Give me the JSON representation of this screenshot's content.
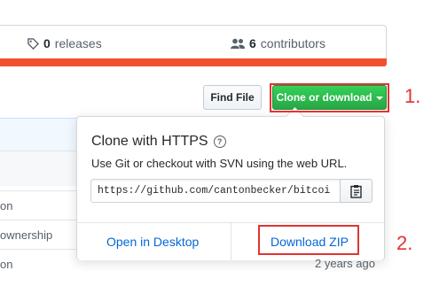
{
  "stats": {
    "releases_count": "0",
    "releases_label": "releases",
    "contributors_count": "6",
    "contributors_label": "contributors"
  },
  "toolbar": {
    "find_file_label": "Find File",
    "clone_label": "Clone or download"
  },
  "popover": {
    "title": "Clone with HTTPS",
    "help_glyph": "?",
    "description": "Use Git or checkout with SVN using the web URL.",
    "url": "https://github.com/cantonbecker/bitcoi",
    "open_desktop_label": "Open in Desktop",
    "download_zip_label": "Download ZIP"
  },
  "file_list": {
    "rows": [
      "on",
      "ownership",
      "on"
    ]
  },
  "timestamp": "2 years ago",
  "annotations": {
    "step1": "1.",
    "step2": "2."
  },
  "colors": {
    "accent_green": "#28a745",
    "link_blue": "#0366d6",
    "annotation_red": "#e03434",
    "language_bar": "#f1502f"
  }
}
